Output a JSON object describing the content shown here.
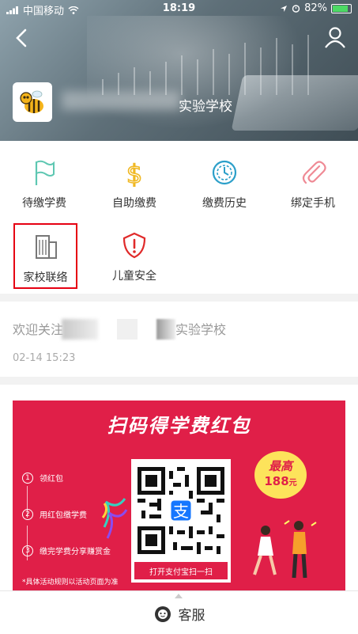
{
  "status_bar": {
    "carrier": "中国移动",
    "time": "18:19",
    "battery": "82%"
  },
  "header": {
    "school_name": "实验学校"
  },
  "menu": {
    "items": [
      {
        "label": "待缴学费",
        "icon": "flag-icon"
      },
      {
        "label": "自助缴费",
        "icon": "dollar-icon"
      },
      {
        "label": "缴费历史",
        "icon": "history-clock-icon"
      },
      {
        "label": "绑定手机",
        "icon": "paperclip-icon"
      },
      {
        "label": "家校联络",
        "icon": "building-icon"
      },
      {
        "label": "儿童安全",
        "icon": "shield-alert-icon"
      }
    ]
  },
  "notice": {
    "title_prefix": "欢迎关注",
    "title_suffix": "实验学校",
    "time": "02-14 15:23"
  },
  "banner": {
    "title": "扫码得学费红包",
    "steps": [
      "领红包",
      "用红包缴学费",
      "缴完学费分享赚赏金"
    ],
    "rule": "*具体活动规则以活动页面为准",
    "qr_caption": "打开支付宝扫一扫",
    "badge_top": "最高",
    "badge_amount": "188",
    "badge_unit": "元"
  },
  "bottom": {
    "service_label": "客服"
  },
  "colors": {
    "banner_red": "#e01f48",
    "select_border": "#e60012",
    "badge_yellow": "#fde35b"
  }
}
